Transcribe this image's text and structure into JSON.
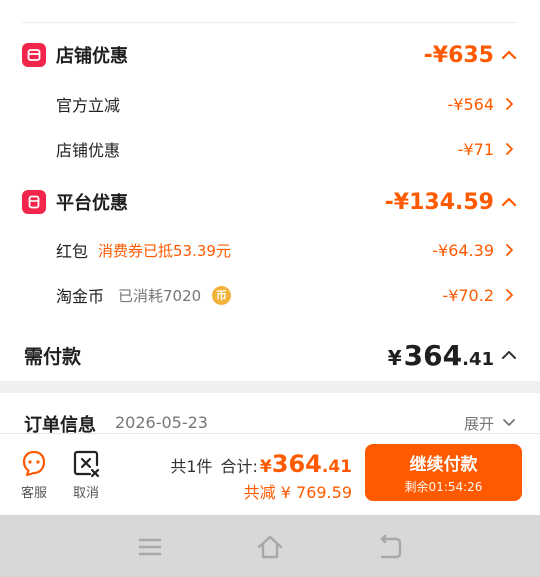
{
  "store_discount": {
    "title": "店铺优惠",
    "amount": "-¥635",
    "items": [
      {
        "label": "官方立减",
        "amount": "-¥564"
      },
      {
        "label": "店铺优惠",
        "amount": "-¥71"
      }
    ]
  },
  "platform_discount": {
    "title": "平台优惠",
    "amount": "-¥134.59",
    "red_packet": {
      "label": "红包",
      "tag": "消费券已抵53.39元",
      "amount": "-¥64.39"
    },
    "taojinbi": {
      "label": "淘金币",
      "tag": "已消耗7020",
      "coin_glyph": "币",
      "amount": "-¥70.2"
    }
  },
  "payable": {
    "label": "需付款",
    "currency": "¥",
    "integer": "364",
    "decimal": ".41"
  },
  "order_info": {
    "title": "订单信息",
    "date": "2026-05-23",
    "expand_label": "展开"
  },
  "bottom_bar": {
    "service_label": "客服",
    "cancel_label": "取消",
    "count": "共1件",
    "total_label": "合计:",
    "total_currency": "¥",
    "total_int": "364",
    "total_dec": ".41",
    "saved": "共减 ¥ 769.59",
    "pay_button": "继续付款",
    "countdown": "剩余01:54:26"
  },
  "colors": {
    "accent": "#ff5a00",
    "badge": "#f2264b",
    "coin": "#f3b23a"
  },
  "icons": [
    "store-badge-icon",
    "platform-badge-icon",
    "chevron-up-icon",
    "chevron-right-icon",
    "chevron-down-icon",
    "customer-service-icon",
    "cancel-icon",
    "menu-icon",
    "home-icon",
    "back-icon"
  ]
}
